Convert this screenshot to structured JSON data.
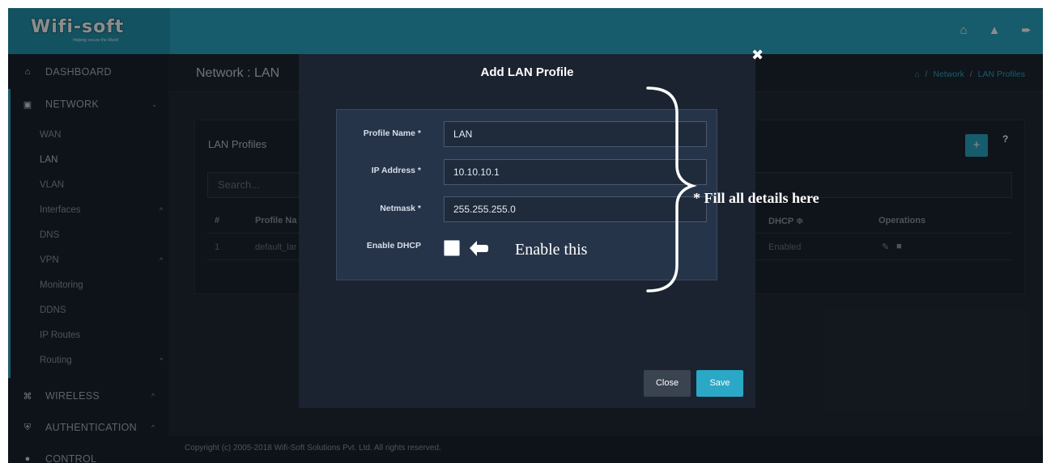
{
  "brand": {
    "name": "Wifi-soft",
    "tagline": "Helping secure the World"
  },
  "topbar": {
    "icons": [
      "home-icon",
      "bell-icon",
      "logout-icon"
    ]
  },
  "sidebar": {
    "sections": [
      {
        "label": "DASHBOARD",
        "icon": "home-icon"
      },
      {
        "label": "NETWORK",
        "icon": "monitor-icon",
        "chevron": "⌄"
      },
      {
        "label": "WIRELESS",
        "icon": "wifi-icon",
        "chevron": "^"
      },
      {
        "label": "AUTHENTICATION",
        "icon": "shield-icon",
        "chevron": "^"
      },
      {
        "label": "CONTROL",
        "icon": "control-icon"
      }
    ],
    "network_items": [
      {
        "label": "WAN"
      },
      {
        "label": "LAN"
      },
      {
        "label": "VLAN"
      },
      {
        "label": "Interfaces",
        "chevron": "^"
      },
      {
        "label": "DNS"
      },
      {
        "label": "VPN",
        "chevron": "^"
      },
      {
        "label": "Monitoring"
      },
      {
        "label": "DDNS"
      },
      {
        "label": "IP Routes"
      },
      {
        "label": "Routing",
        "chevron": "^"
      }
    ]
  },
  "page": {
    "title": "Network : LAN",
    "breadcrumb": [
      "Network",
      "LAN Profiles"
    ],
    "breadcrumb_sep": "/"
  },
  "panel": {
    "title": "LAN Profiles",
    "add_label": "+",
    "help_label": "?",
    "search_placeholder": "Search...",
    "columns": {
      "index": "#",
      "profile_name": "Profile Na",
      "dhcp": "DHCP ≑",
      "operations": "Operations"
    },
    "rows": [
      {
        "index": "1",
        "profile_name": "default_lar",
        "dhcp": "Enabled"
      }
    ]
  },
  "footer": {
    "text": "Copyright (c) 2005-2018 Wifi-Soft Solutions Pvt. Ltd. All rights reserved."
  },
  "modal": {
    "title": "Add LAN Profile",
    "close_symbol": "✖",
    "fields": {
      "profile_name": {
        "label": "Profile Name *",
        "value": "LAN"
      },
      "ip_address": {
        "label": "IP Address *",
        "value": "10.10.10.1"
      },
      "netmask": {
        "label": "Netmask *",
        "value": "255.255.255.0"
      },
      "enable_dhcp": {
        "label": "Enable DHCP",
        "checked": false
      }
    },
    "close_label": "Close",
    "save_label": "Save"
  },
  "annotations": {
    "enable_this": "Enable this",
    "fill_details": "* Fill all details here"
  },
  "colors": {
    "accent": "#2aa8c5",
    "panel": "#1c2430",
    "modal": "#1b2330",
    "form": "#26344a"
  }
}
